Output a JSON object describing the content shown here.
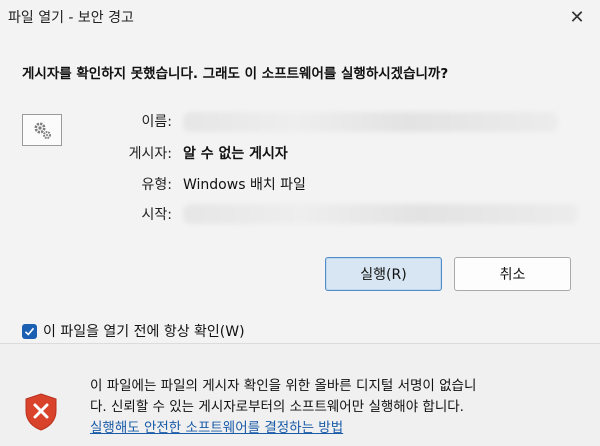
{
  "window": {
    "title": "파일 열기 - 보안 경고",
    "close_glyph": "✕"
  },
  "dialog": {
    "question": "게시자를 확인하지 못했습니다.  그래도 이 소프트웨어를 실행하시겠습니까?",
    "fields": {
      "name_label": "이름:",
      "publisher_label": "게시자:",
      "publisher_value": "알 수 없는 게시자",
      "type_label": "유형:",
      "type_value": "Windows 배치 파일",
      "from_label": "시작:"
    },
    "run_button": "실행(R)",
    "cancel_button": "취소",
    "checkbox_label": "이 파일을 열기 전에 항상 확인(W)",
    "checkbox_checked": true
  },
  "footer": {
    "warning_line1": "이 파일에는 파일의 게시자 확인을 위한 올바른 디지털 서명이 없습니",
    "warning_line2": "다. 신뢰할 수 있는 게시자로부터의 소프트웨어만 실행해야 합니다.",
    "help_link": "실행해도 안전한 소프트웨어를 결정하는 방법"
  },
  "icons": {
    "file": "settings-gear-file-icon",
    "warning": "security-shield-x-icon",
    "check": "checkmark-icon"
  },
  "colors": {
    "accent": "#1b5fb3",
    "link": "#1a5ba8",
    "shield_red": "#d9422b"
  }
}
